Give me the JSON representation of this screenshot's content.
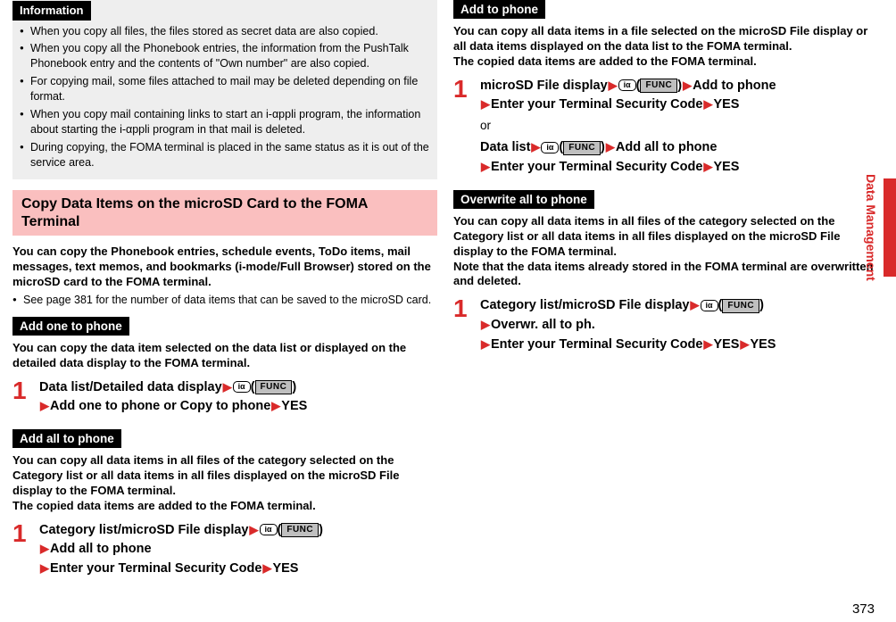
{
  "sideText": "Data Management",
  "pageNum": "373",
  "leftCol": {
    "infoLabel": "Information",
    "infoItems": [
      "When you copy all files, the files stored as secret data are also copied.",
      "When you copy all the Phonebook entries, the information from the PushTalk Phonebook entry and the contents of \"Own number\" are also copied.",
      "For copying mail, some files attached to mail may be deleted depending on file format.",
      "When you copy mail containing links to start an i-αppli program, the information about starting the i-αppli program in that mail is deleted.",
      "During copying, the FOMA terminal is placed in the same status as it is out of the service area."
    ],
    "pinkHeading": "Copy Data Items on the microSD Card to the FOMA Terminal",
    "pinkIntro": "You can copy the Phonebook entries, schedule events, ToDo items, mail messages, text memos, and bookmarks (i-mode/Full Browser) stored on the microSD card to the FOMA terminal.",
    "pinkNote": "See page 381 for the number of data items that can be saved to the microSD card.",
    "sections": [
      {
        "label": "Add one to phone",
        "desc": "You can copy the data item selected on the data list or displayed on the detailed data display to the FOMA terminal.",
        "stepNum": "1",
        "line1a": "Data list/Detailed data display",
        "func": "FUNC",
        "line2a": "Add one to phone or Copy to phone",
        "yes": "YES"
      },
      {
        "label": "Add all to phone",
        "desc": "You can copy all data items in all files of the category selected on the Category list or all data items in all files displayed on the microSD File display to the FOMA terminal.\nThe copied data items are added to the FOMA terminal.",
        "stepNum": "1",
        "line1a": "Category list/microSD File display",
        "func": "FUNC",
        "line2a": "Add all to phone",
        "line3a": "Enter your Terminal Security Code",
        "yes": "YES"
      }
    ]
  },
  "rightCol": {
    "sections": [
      {
        "label": "Add to phone",
        "desc": "You can copy all data items in a file selected on the microSD File display or all data items displayed on the data list to the FOMA terminal.\nThe copied data items are added to the FOMA terminal.",
        "stepNum": "1",
        "line1": "microSD File display",
        "func": "FUNC",
        "line1b": "Add to phone",
        "line2": "Enter your Terminal Security Code",
        "yes": "YES",
        "or": "or",
        "line3": "Data list",
        "line3b": "Add all to phone",
        "line4": "Enter your Terminal Security Code"
      },
      {
        "label": "Overwrite all to phone",
        "desc": "You can copy all data items in all files of the category selected on the Category list or all data items in all files displayed on the microSD File display to the FOMA terminal.\nNote that the data items already stored in the FOMA terminal are overwritten and deleted.",
        "stepNum": "1",
        "line1": "Category list/microSD File display",
        "func": "FUNC",
        "line2": "Overwr. all to ph.",
        "line3": "Enter your Terminal Security Code",
        "yes": "YES",
        "yes2": "YES"
      }
    ]
  },
  "iappli_alpha": "α",
  "key_i": "iα"
}
